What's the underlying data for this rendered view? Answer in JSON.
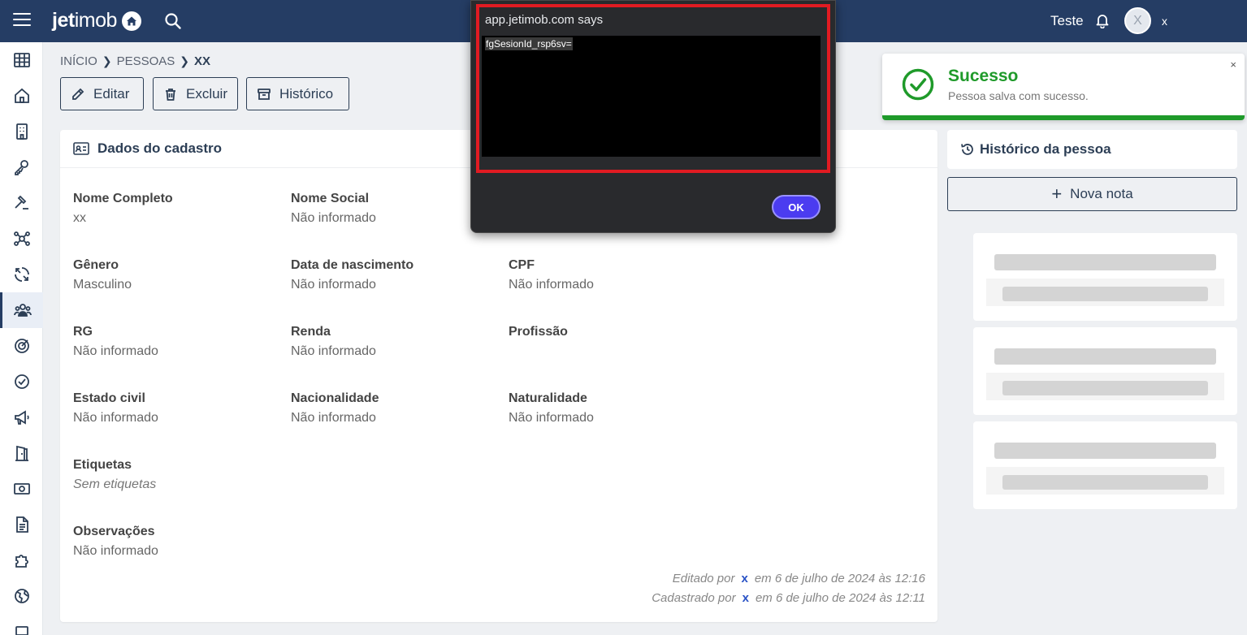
{
  "topbar": {
    "logo_bold": "jet",
    "logo_thin": "imob",
    "user_name": "Teste",
    "avatar_letter": "X",
    "user_short": "x"
  },
  "sidebar": {
    "items": [
      "grid",
      "home",
      "building",
      "key",
      "auction",
      "network",
      "sync",
      "people",
      "target",
      "check",
      "megaphone",
      "door",
      "money",
      "document",
      "puzzle",
      "globe",
      "laptop"
    ],
    "active": "people"
  },
  "breadcrumb": {
    "items": [
      "INÍCIO",
      "PESSOAS"
    ],
    "current": "XX"
  },
  "actions": {
    "edit": "Editar",
    "delete": "Excluir",
    "history": "Histórico"
  },
  "card": {
    "title": "Dados do cadastro",
    "fields": {
      "nome_completo": {
        "label": "Nome Completo",
        "value": "xx"
      },
      "nome_social": {
        "label": "Nome Social",
        "value": "Não informado"
      },
      "genero": {
        "label": "Gênero",
        "value": "Masculino"
      },
      "data_nascimento": {
        "label": "Data de nascimento",
        "value": "Não informado"
      },
      "cpf": {
        "label": "CPF",
        "value": "Não informado"
      },
      "rg": {
        "label": "RG",
        "value": "Não informado"
      },
      "renda": {
        "label": "Renda",
        "value": "Não informado"
      },
      "profissao": {
        "label": "Profissão",
        "value": ""
      },
      "estado_civil": {
        "label": "Estado civil",
        "value": "Não informado"
      },
      "nacionalidade": {
        "label": "Nacionalidade",
        "value": "Não informado"
      },
      "naturalidade": {
        "label": "Naturalidade",
        "value": "Não informado"
      },
      "etiquetas": {
        "label": "Etiquetas",
        "value": "Sem etiquetas"
      },
      "observacoes": {
        "label": "Observações",
        "value": "Não informado"
      }
    },
    "footer": {
      "edited_prefix": "Editado por",
      "edited_by": "x",
      "edited_when": "em 6 de julho de 2024 às 12:16",
      "created_prefix": "Cadastrado por",
      "created_by": "x",
      "created_when": "em 6 de julho de 2024 às 12:11"
    }
  },
  "toast": {
    "title": "Sucesso",
    "message": "Pessoa salva com sucesso.",
    "close": "×",
    "color": "#1f9a2a"
  },
  "history_panel": {
    "title": "Histórico da pessoa",
    "new_note": "Nova nota"
  },
  "dialog": {
    "title": "app.jetimob.com says",
    "text": "fgSesionId_rsp6sv=",
    "ok": "OK"
  }
}
